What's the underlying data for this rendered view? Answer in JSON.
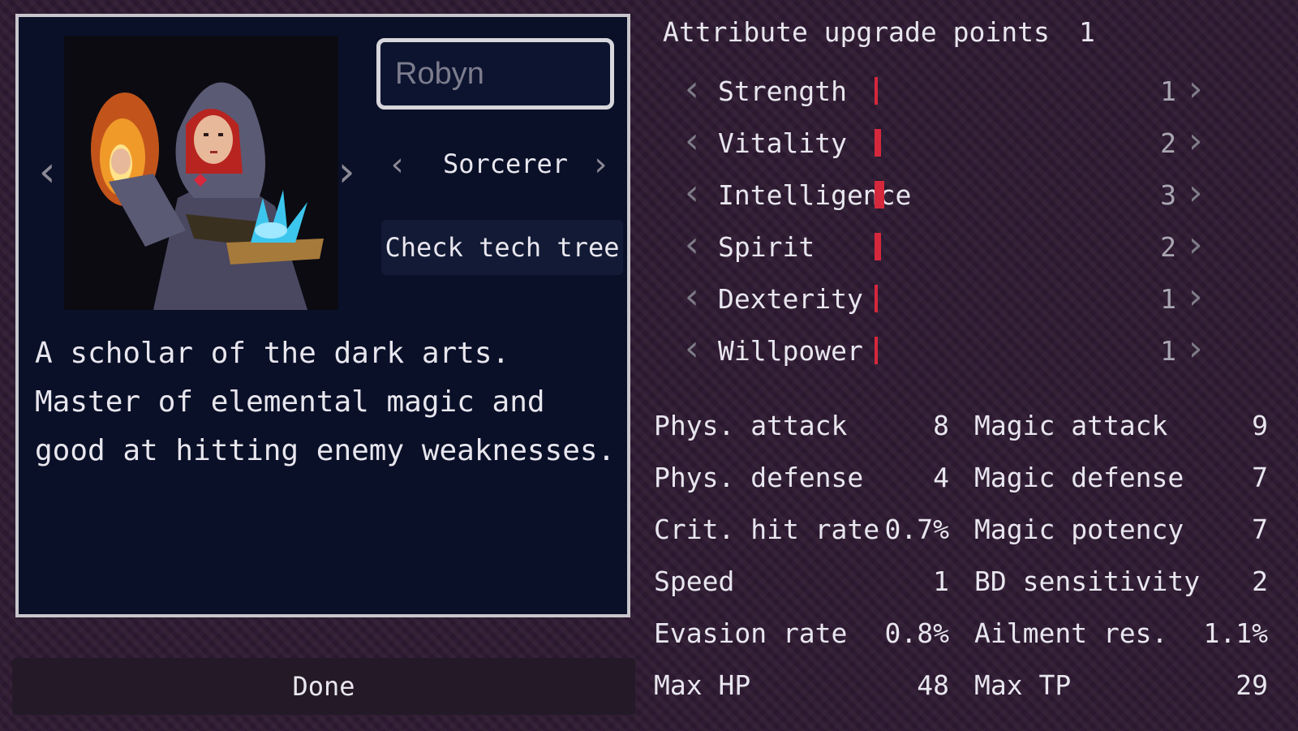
{
  "character": {
    "name": "Robyn",
    "class": "Sorcerer",
    "tech_tree_label": "Check tech tree",
    "description": "A scholar of the dark arts.\nMaster of elemental magic and\ngood at hitting enemy weaknesses.",
    "done_label": "Done"
  },
  "upgrade": {
    "label": "Attribute upgrade points",
    "value": "1"
  },
  "attributes": [
    {
      "name": "Strength",
      "value": "1",
      "level": 1
    },
    {
      "name": "Vitality",
      "value": "2",
      "level": 2
    },
    {
      "name": "Intelligence",
      "value": "3",
      "level": 3
    },
    {
      "name": "Spirit",
      "value": "2",
      "level": 2
    },
    {
      "name": "Dexterity",
      "value": "1",
      "level": 1
    },
    {
      "name": "Willpower",
      "value": "1",
      "level": 1
    }
  ],
  "stats_left": [
    {
      "name": "Phys. attack",
      "value": "8"
    },
    {
      "name": "Phys. defense",
      "value": "4"
    },
    {
      "name": "Crit. hit rate",
      "value": "0.7%"
    },
    {
      "name": "Speed",
      "value": "1"
    },
    {
      "name": "Evasion rate",
      "value": "0.8%"
    },
    {
      "name": "Max HP",
      "value": "48"
    }
  ],
  "stats_right": [
    {
      "name": "Magic attack",
      "value": "9"
    },
    {
      "name": "Magic defense",
      "value": "7"
    },
    {
      "name": "Magic potency",
      "value": "7"
    },
    {
      "name": "BD sensitivity",
      "value": "2"
    },
    {
      "name": "Ailment res.",
      "value": "1.1%"
    },
    {
      "name": "Max TP",
      "value": "29"
    }
  ],
  "icons": {
    "prev": "chevron-left-icon",
    "next": "chevron-right-icon"
  },
  "colors": {
    "background": "#2f1b33",
    "panel": "#0a1028",
    "attribute_bar": "#d6283c"
  }
}
